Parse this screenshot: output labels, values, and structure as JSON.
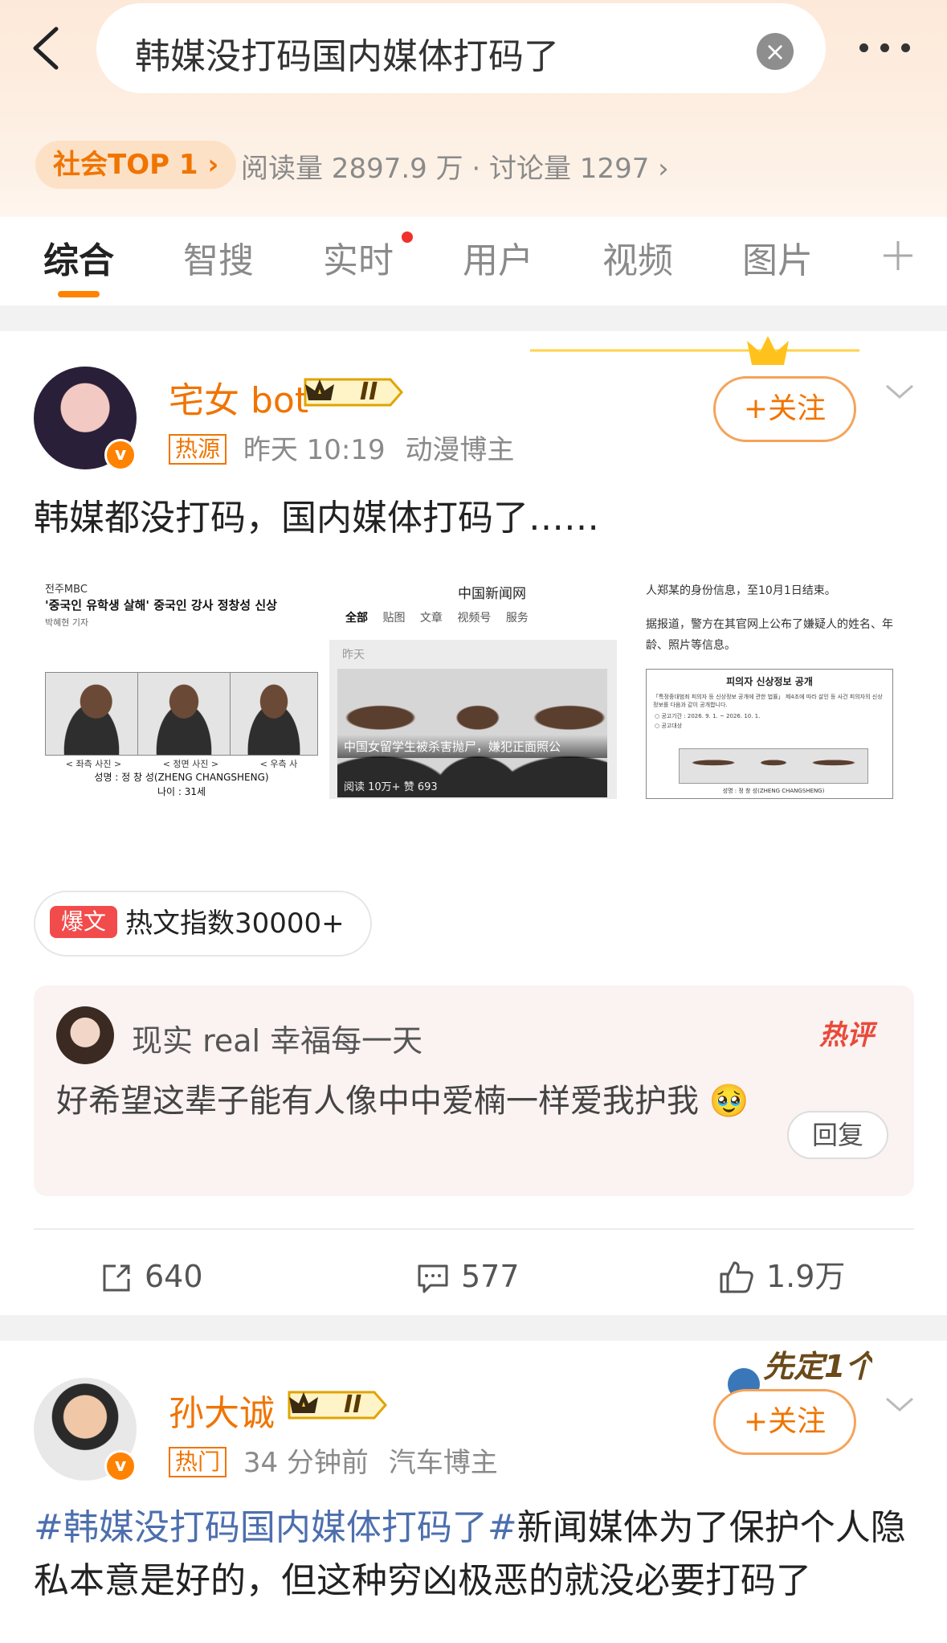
{
  "search": {
    "query": "韩媒没打码国内媒体打码了"
  },
  "topic": {
    "badge": "社会TOP 1",
    "stats": "阅读量 2897.9 万 · 讨论量 1297"
  },
  "tabs": [
    {
      "label": "综合"
    },
    {
      "label": "智搜"
    },
    {
      "label": "实时"
    },
    {
      "label": "用户"
    },
    {
      "label": "视频"
    },
    {
      "label": "图片"
    }
  ],
  "icons": {
    "back": "back-arrow-icon",
    "clear": "clear-icon",
    "more": "more-icon",
    "add_tab": "plus-icon"
  },
  "colors": {
    "accent": "#ff8200",
    "username": "#f07400",
    "hashtag": "#4d6fae",
    "hot_red": "#f24b4b"
  },
  "posts": [
    {
      "username": "宅女 bot",
      "rank": "II",
      "tag": "热源",
      "time": "昨天 10:19",
      "category": "动漫博主",
      "follow_label": "+关注",
      "text": "韩媒都没打码，国内媒体打码了……",
      "images": [
        {
          "source": "전주MBC",
          "headline": "'중국인 유학생 살해' 중국인 강사 정창성 신상",
          "reporter": "박혜현 기자",
          "caption_left": "< 좌측 사진 >",
          "caption_mid": "< 정면 사진 >",
          "caption_right": "< 우측 사",
          "name_line": "성명 : 정 창 성(ZHENG CHANGSHENG)",
          "age_line": "나이 : 31세"
        },
        {
          "site": "中国新闻网",
          "nav": [
            "全部",
            "贴图",
            "文章",
            "视频号",
            "服务"
          ],
          "date": "昨天",
          "overlay_title": "中国女留学生被杀害抛尸，嫌犯正面照公",
          "overlay_stats": "阅读 10万+  赞 693"
        },
        {
          "line1": "人郑某的身份信息，至10月1日结束。",
          "line2": "据报道，警方在其官网上公布了嫌疑人的姓名、年龄、照片等信息。",
          "doc_title": "피의자 신상정보 공개",
          "doc_line": "「특정중대범죄 피의자 등 신상정보 공개에 관한 법률」 제4조에 따라 살인 등 사건 피의자의 신상정보를 다음과 같이 공개합니다.",
          "doc_period": "○ 공고기간 : 2026. 9. 1. ~ 2026. 10. 1.",
          "doc_target": "○ 공고대상",
          "doc_name": "성명 : 정 창 성(ZHENG CHANGSHENG)"
        }
      ],
      "hot_badge": "爆文",
      "hot_index": "热文指数30000+",
      "comment": {
        "author": "现实 real 幸福每一天",
        "label": "热评",
        "text": "好希望这辈子能有人像中中爱楠一样爱我护我",
        "emoji": "🥹",
        "reply_label": "回复"
      },
      "actions": {
        "reposts": "640",
        "comments": "577",
        "likes": "1.9万"
      }
    },
    {
      "username": "孙大诚",
      "rank": "II",
      "tag": "热门",
      "time": "34 分钟前",
      "category": "汽车博主",
      "follow_label": "+关注",
      "sticker": "先定1个小目标",
      "hashtag": "#韩媒没打码国内媒体打码了#",
      "text": "新闻媒体为了保护个人隐私本意是好的，但这种穷凶极恶的就没必要打码了"
    }
  ]
}
